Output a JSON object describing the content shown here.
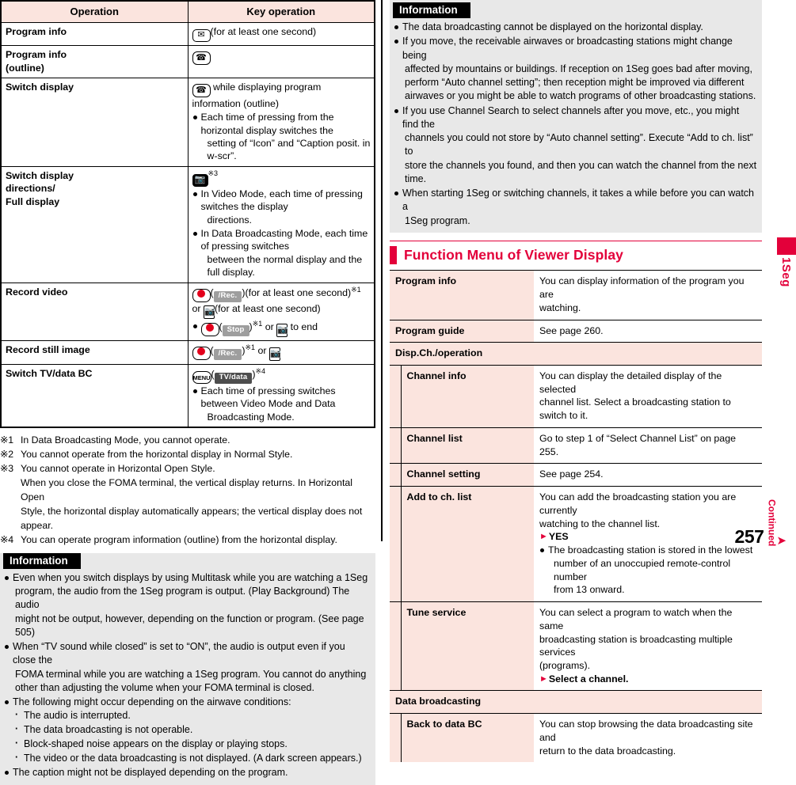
{
  "page": {
    "number": "257",
    "continued_label": "Continued",
    "edge_tab_label": "1Seg",
    "accent_color": "#e3003a",
    "table_header_color": "#fbe4de",
    "info_bg_color": "#e8e8e8"
  },
  "key_table": {
    "headers": [
      "Operation",
      "Key operation"
    ],
    "rows": [
      {
        "operation": "Program info",
        "key_icon": "mail-key-icon",
        "key_text": "(for at least one second)",
        "bullets": []
      },
      {
        "operation": "Program info\n(outline)",
        "key_icon": "call-key-icon",
        "key_text": "",
        "bullets": []
      },
      {
        "operation": "Switch display",
        "key_icon": "call-key-icon",
        "key_text": "while displaying program information (outline)",
        "bullets": [
          {
            "text": "Each time of pressing from the horizontal display switches the",
            "cont": "setting of “Icon” and “Caption posit. in w-scr”."
          }
        ]
      },
      {
        "operation": "Switch display\ndirections/\nFull display",
        "key_icon": "camera-key-icon",
        "key_text": "",
        "key_note": "※3",
        "bullets": [
          {
            "text": "In Video Mode, each time of pressing switches the display",
            "cont": "directions."
          },
          {
            "text": "In Data Broadcasting Mode, each time of pressing switches",
            "cont": "between the normal display and the full display."
          }
        ]
      },
      {
        "operation": "Record video",
        "key_icon": "c-key-icon",
        "soft_label": "/Rec.",
        "key_text": "(for at least one second)",
        "key_note": "※1",
        "key_text2": "or",
        "key_icon2": "camera-side-key-icon",
        "key_text3": "(for at least one second)",
        "bullets": [
          {
            "icon": "c-key-icon",
            "soft_label": "Stop",
            "note": "※1",
            "tail": "or",
            "icon2": "camera-side-key-icon",
            "tail2": "to end"
          }
        ]
      },
      {
        "operation": "Record still image",
        "key_icon": "c-key-icon",
        "soft_label": "/Rec.",
        "key_note": "※1",
        "key_text2": "or",
        "key_icon2": "camera-side-key-icon",
        "bullets": []
      },
      {
        "operation": "Switch TV/data BC",
        "key_icon": "menu-key-icon",
        "soft_label": "TV/data",
        "key_note": "※4",
        "bullets": [
          {
            "text": "Each time of pressing switches between Video Mode and Data",
            "cont": "Broadcasting Mode."
          }
        ]
      }
    ]
  },
  "footnotes": [
    {
      "mark": "※1",
      "lines": [
        "In Data Broadcasting Mode, you cannot operate."
      ]
    },
    {
      "mark": "※2",
      "lines": [
        "You cannot operate from the horizontal display in Normal Style."
      ]
    },
    {
      "mark": "※3",
      "lines": [
        "You cannot operate in Horizontal Open Style.",
        "When you close the FOMA terminal, the vertical display returns. In Horizontal Open",
        "Style, the horizontal display automatically appears; the vertical display does not appear."
      ]
    },
    {
      "mark": "※4",
      "lines": [
        "You can operate program information (outline) from the horizontal display."
      ]
    }
  ],
  "info_left": {
    "title": "Information",
    "items": [
      {
        "lines": [
          "Even when you switch displays by using Multitask while you are watching a 1Seg",
          "program, the audio from the 1Seg program is output. (Play Background) The audio",
          "might not be output, however, depending on the function or program. (See page 505)"
        ]
      },
      {
        "lines": [
          "When “TV sound while closed” is set to “ON”, the audio is output even if you close the",
          "FOMA terminal while you are watching a 1Seg program. You cannot do anything",
          "other than adjusting the volume when your FOMA terminal is closed."
        ]
      },
      {
        "lines": [
          "The following might occur depending on the airwave conditions:"
        ],
        "subs": [
          "The audio is interrupted.",
          "The data broadcasting is not operable.",
          "Block-shaped noise appears on the display or playing stops.",
          "The video or the data broadcasting is not displayed. (A dark screen appears.)"
        ]
      },
      {
        "lines": [
          "The caption might not be displayed depending on the program."
        ]
      }
    ]
  },
  "info_right": {
    "title": "Information",
    "items": [
      {
        "lines": [
          "The data broadcasting cannot be displayed on the horizontal display."
        ]
      },
      {
        "lines": [
          "If you move, the receivable airwaves or broadcasting stations might change being",
          "affected by mountains or buildings. If reception on 1Seg goes bad after moving,",
          "perform “Auto channel setting”; then reception might be improved via different",
          "airwaves or you might be able to watch programs of other broadcasting stations."
        ]
      },
      {
        "lines": [
          "If you use Channel Search to select channels after you move, etc., you might find the",
          "channels you could not store by “Auto channel setting”. Execute “Add to ch. list” to",
          "store the channels you found, and then you can watch the channel from the next time."
        ]
      },
      {
        "lines": [
          "When starting 1Seg or switching channels, it takes a while before you can watch a",
          "1Seg program."
        ]
      }
    ]
  },
  "section": {
    "title": "Function Menu of Viewer Display"
  },
  "function_menu": [
    {
      "kind": "item",
      "name": "Program info",
      "desc_lines": [
        "You can display information of the program you are",
        "watching."
      ]
    },
    {
      "kind": "item",
      "name": "Program guide",
      "desc_lines": [
        "See page 260."
      ]
    },
    {
      "kind": "group",
      "name": "Disp.Ch./operation"
    },
    {
      "kind": "subitem",
      "name": "Channel info",
      "desc_lines": [
        "You can display the detailed display of the selected",
        "channel list. Select a broadcasting station to switch to it."
      ]
    },
    {
      "kind": "subitem",
      "name": "Channel list",
      "desc_lines": [
        "Go to step 1 of “Select Channel List” on page 255."
      ]
    },
    {
      "kind": "subitem",
      "name": "Channel setting",
      "desc_lines": [
        "See page 254."
      ]
    },
    {
      "kind": "subitem",
      "name": "Add to ch. list",
      "desc_lines": [
        "You can add the broadcasting station you are currently",
        "watching to the channel list."
      ],
      "arrow_line": "YES",
      "bullet": {
        "lines": [
          "The broadcasting station is stored in the lowest",
          "number of an unoccupied remote-control number",
          "from 13 onward."
        ]
      }
    },
    {
      "kind": "subitem",
      "name": "Tune service",
      "desc_lines": [
        "You can select a program to watch when the same",
        "broadcasting station is broadcasting multiple services",
        "(programs)."
      ],
      "arrow_line": "Select a channel."
    },
    {
      "kind": "group",
      "name": "Data broadcasting"
    },
    {
      "kind": "subitem",
      "name": "Back to data BC",
      "desc_lines": [
        "You can stop browsing the data broadcasting site and",
        "return to the data broadcasting."
      ]
    }
  ]
}
